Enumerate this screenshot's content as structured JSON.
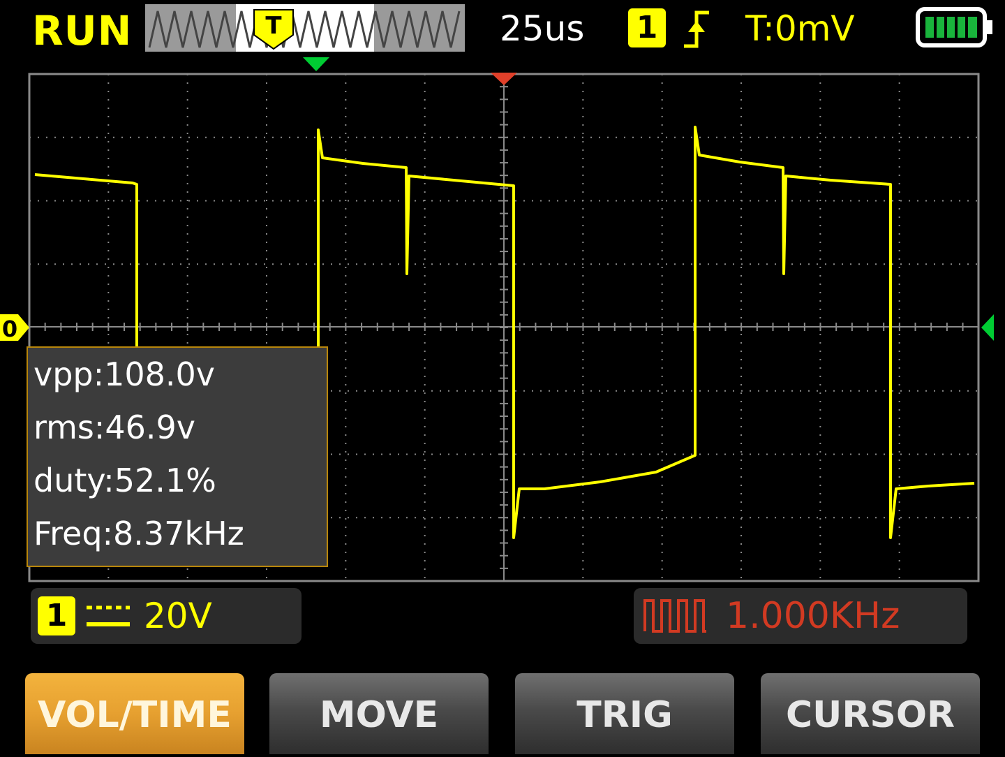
{
  "status": {
    "run_state": "RUN",
    "timebase": "25us",
    "trigger_channel": "1",
    "trigger_edge": "rising-edge-icon",
    "trigger_level": "T:0mV",
    "battery": "battery-full-icon",
    "overview_marker": "T"
  },
  "measurements": {
    "vpp": "vpp:108.0v",
    "rms": "rms:46.9v",
    "duty": "duty:52.1%",
    "freq": "Freq:8.37kHz"
  },
  "channel": {
    "number": "1",
    "coupling_icon": "dc-coupling-icon",
    "scale": "20V",
    "ground_marker": "0"
  },
  "generator": {
    "icon": "square-wave-icon",
    "frequency": "1.000KHz"
  },
  "softkeys": [
    "VOL/TIME",
    "MOVE",
    "TRIG",
    "CURSOR"
  ],
  "colors": {
    "trace": "#ffff00",
    "grid": "#8a8a8a",
    "generator": "#d23a22",
    "active_key": "#e6a030",
    "trigger_pos": "#00cc33",
    "center_marker": "#e0402a"
  }
}
